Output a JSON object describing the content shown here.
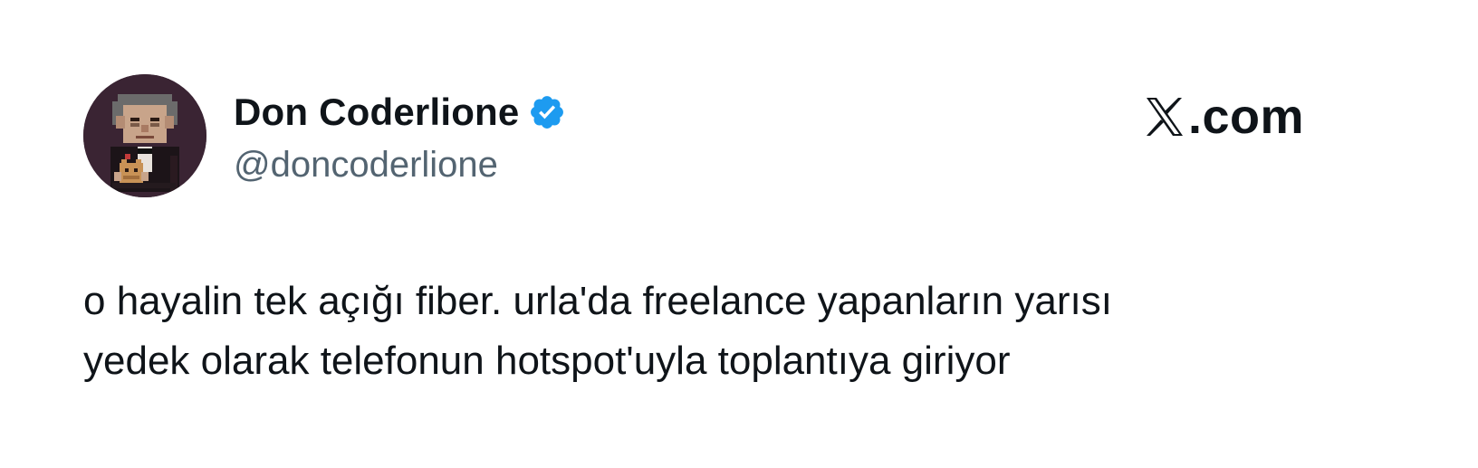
{
  "author": {
    "display_name": "Don Coderlione",
    "handle": "@doncoderlione",
    "verified": true,
    "avatar_icon": "pixel-art-mafia-boss-avatar"
  },
  "brand": {
    "logo_icon": "x-logo-icon",
    "text": ".com"
  },
  "tweet": {
    "lines": [
      "o hayalin tek açığı fiber. urla'da freelance yapanların yarısı",
      "yedek olarak telefonun hotspot'uyla toplantıya giriyor"
    ]
  },
  "colors": {
    "text": "#0f1419",
    "secondary_text": "#536471",
    "verified_blue": "#1d9bf0",
    "avatar_bg": "#3a2433"
  }
}
